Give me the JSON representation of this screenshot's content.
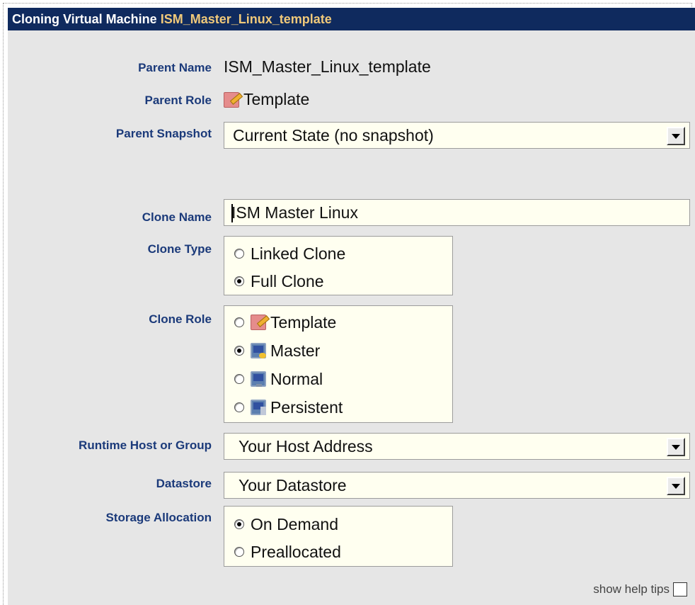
{
  "window": {
    "title_prefix": "Cloning Virtual Machine",
    "title_vm_name": "ISM_Master_Linux_template"
  },
  "parent": {
    "name_label": "Parent Name",
    "name_value": "ISM_Master_Linux_template",
    "role_label": "Parent Role",
    "role_value": "Template",
    "role_icon": "template-icon",
    "snapshot_label": "Parent Snapshot",
    "snapshot_value": "Current State (no snapshot)"
  },
  "clone": {
    "name_label": "Clone Name",
    "name_value": "ISM Master Linux",
    "type_label": "Clone Type",
    "type_options": [
      {
        "label": "Linked Clone",
        "selected": false
      },
      {
        "label": "Full Clone",
        "selected": true
      }
    ],
    "role_label": "Clone Role",
    "role_options": [
      {
        "label": "Template",
        "icon": "template-icon",
        "selected": false
      },
      {
        "label": "Master",
        "icon": "master-monitor-icon",
        "selected": true
      },
      {
        "label": "Normal",
        "icon": "monitor-icon",
        "selected": false
      },
      {
        "label": "Persistent",
        "icon": "persistent-monitor-icon",
        "selected": false
      }
    ]
  },
  "runtime": {
    "host_label": "Runtime Host or Group",
    "host_value": "Your Host Address",
    "datastore_label": "Datastore",
    "datastore_value": "Your Datastore"
  },
  "storage": {
    "label": "Storage Allocation",
    "options": [
      {
        "label": "On Demand",
        "selected": true
      },
      {
        "label": "Preallocated",
        "selected": false
      }
    ]
  },
  "footer": {
    "help_tips_label": "show help tips",
    "help_tips_checked": false
  },
  "colors": {
    "title_bar": "#0f2a5e",
    "title_vm_name": "#f0c97a",
    "label_text": "#1b3a7a",
    "field_bg": "#fffff0",
    "panel_bg": "#e6e6e6"
  }
}
